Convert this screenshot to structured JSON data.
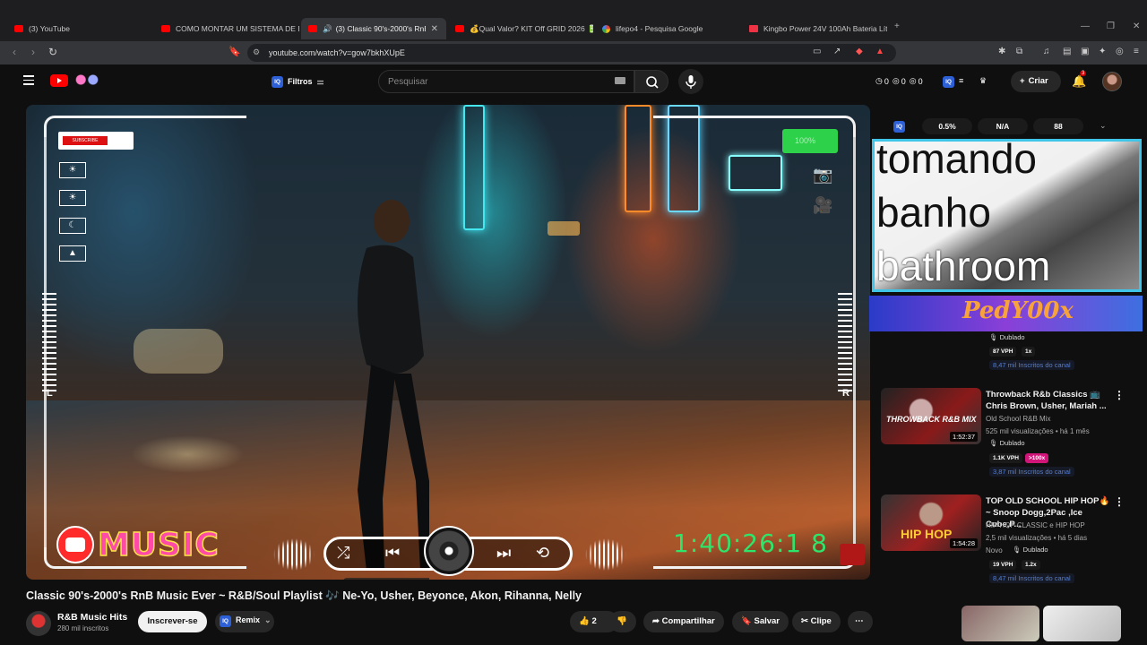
{
  "browser": {
    "tabs": [
      {
        "title": "(3) YouTube",
        "active": false
      },
      {
        "title": "COMO MONTAR UM SISTEMA DE EN",
        "active": false
      },
      {
        "title": "(3) Classic 90's-2000's RnB M",
        "active": true
      },
      {
        "title": "💰Qual Valor? KIT Off GRID 2026 🔋🪫",
        "active": false
      },
      {
        "title": "lifepo4 - Pesquisa Google",
        "active": false
      },
      {
        "title": "Kingbo Power 24V 100Ah Bateria Lít",
        "active": false
      }
    ],
    "url": "youtube.com/watch?v=gow7bkhXUpE"
  },
  "header": {
    "filters_label": "Filtros",
    "search_placeholder": "Pesquisar",
    "counters": [
      "0",
      "0",
      "0"
    ],
    "create_label": "Criar",
    "notifications_count": "3"
  },
  "player": {
    "subscribe_sticker": "SUBSCRIBE",
    "battery_text": "100%",
    "meter_left_label": "L",
    "meter_right_label": "R",
    "logo_text": "MUSIC",
    "timecode": "1:40:26:1 8"
  },
  "side_stats": {
    "iq": "IQ",
    "percent": "0.5%",
    "na": "N/A",
    "score": "88"
  },
  "overlay_caption": {
    "line1": "tomando",
    "line2": "banho",
    "line3": "bathroom"
  },
  "banner_text": "PedY00x",
  "recommendations": [
    {
      "dub_label": "Dublado",
      "vph": "87 VPH",
      "mult": "1x",
      "subs": "8,47 mil Inscritos do canal"
    },
    {
      "title": "Throwback R&b Classics 📺 Chris Brown, Usher, Mariah ...",
      "channel": "Old School R&B Mix",
      "meta": "525 mil visualizações • há 1 mês",
      "duration": "1:52:37",
      "thumb_text": "THROWBACK R&B MIX",
      "dub_label": "Dublado",
      "vph": "1.1K VPH",
      "mult": ">100x",
      "subs": "3,87 mil Inscritos do canal"
    },
    {
      "title": "TOP OLD SCHOOL HIP HOP🔥~ Snoop Dogg,2Pac ,Ice Cube,P...",
      "channel": "HIP HOP CLASSIC e HIP HOP",
      "meta": "2,5 mil visualizações • há 5 dias",
      "duration": "1:54:28",
      "thumb_text": "HIP HOP",
      "new_label": "Novo",
      "dub_label": "Dublado",
      "vph": "19 VPH",
      "mult": "1.2x",
      "subs": "8,47 mil Inscritos do canal"
    }
  ],
  "video": {
    "title": "Classic 90's-2000's RnB Music Ever ~ R&B/Soul Playlist 🎶 Ne-Yo, Usher, Beyonce, Akon, Rihanna, Nelly",
    "channel_name": "R&B Music Hits",
    "channel_subs": "280 mil inscritos",
    "subscribe_label": "Inscrever-se",
    "remix_label": "Remix",
    "likes": "2",
    "share_label": "Compartilhar",
    "save_label": "Salvar",
    "clip_label": "Clipe"
  }
}
